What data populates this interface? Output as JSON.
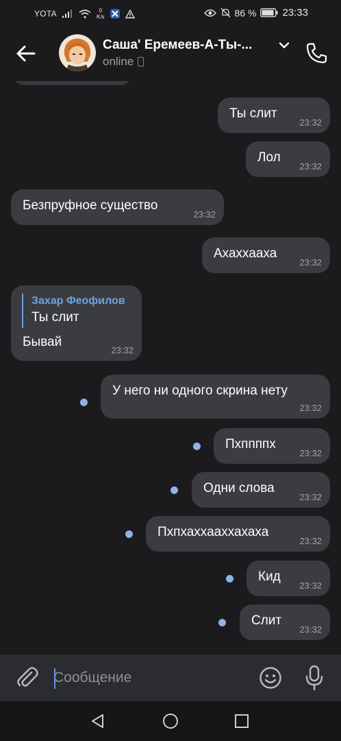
{
  "status_bar": {
    "carrier": "YOTA",
    "speed_value": "0",
    "speed_unit": "K/s",
    "battery_percent": "86 %",
    "time": "23:33"
  },
  "header": {
    "title": "Саша' Еремеев-А-Ты-...",
    "status": "online"
  },
  "messages": [
    {
      "side": "out",
      "text": "Ты слит",
      "time": "23:32",
      "unread": false
    },
    {
      "side": "out",
      "text": "Лол",
      "time": "23:32",
      "unread": false
    },
    {
      "side": "in",
      "text": "Безпруфное существо",
      "time": "23:32"
    },
    {
      "side": "out",
      "text": "Ахаххааха",
      "time": "23:32",
      "unread": false
    },
    {
      "side": "in",
      "reply_author": "Захар Феофилов",
      "reply_text": "Ты слит",
      "text": "Бывай",
      "time": "23:32"
    },
    {
      "side": "out",
      "text": "У него ни одного скрина нету",
      "time": "23:32",
      "unread": true
    },
    {
      "side": "out",
      "text": "Пхппппх",
      "time": "23:32",
      "unread": true
    },
    {
      "side": "out",
      "text": "Одни слова",
      "time": "23:32",
      "unread": true
    },
    {
      "side": "out",
      "text": "Пхпхаххааххахаха",
      "time": "23:32",
      "unread": true
    },
    {
      "side": "out",
      "text": "Кид",
      "time": "23:32",
      "unread": true
    },
    {
      "side": "out",
      "text": "Слит",
      "time": "23:32",
      "unread": true
    }
  ],
  "composer": {
    "placeholder": "Сообщение"
  },
  "colors": {
    "background": "#1b1b1d",
    "bubble": "#3b3c3f",
    "accent": "#6ea3e0",
    "unread_dot": "#8fb3e6"
  }
}
